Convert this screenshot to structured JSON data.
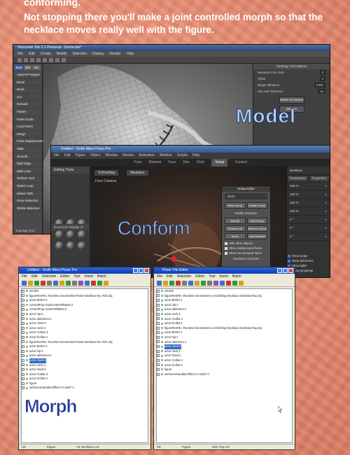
{
  "intro": {
    "line1": "conforming.",
    "line2": "Not stopping there you'll make a joint controlled morph so that the necklace moves really well with the figure."
  },
  "hexagon": {
    "title": "Hexcenter Silo 2.2 Personal - Scene.silo*",
    "menu": [
      "File",
      "Edit",
      "Create",
      "Modify",
      "Selection",
      "Display",
      "Render",
      "Help"
    ],
    "side_tabs": [
      "Mod",
      "Sel",
      "UV"
    ],
    "side_items": [
      "Append Polygon",
      "Bevel",
      "Bend",
      "Cut",
      "Extrude",
      "Flatten",
      "Insert Scale",
      "Local Move",
      "Merge",
      "Point Displacement",
      "Slide",
      "Smooth",
      "Split Edge",
      "Split Loop",
      "Surface Tool",
      "Select Loop",
      "Select Path",
      "Grow Selection",
      "Shrink Selection"
    ],
    "side_footer": "Topology Tool",
    "panel_title": "Topology Tool Options",
    "panel_rows": [
      {
        "label": "Maximum Face Size",
        "value": "0"
      },
      {
        "label": "Offset",
        "value": "0"
      },
      {
        "label": "Merge Tolerance",
        "value": "0.001"
      },
      {
        "label": "Use Auto Tolerance",
        "value": "on"
      }
    ],
    "panel_buttons": [
      "Delete All Strokes",
      "Initialize"
    ],
    "label": "Model",
    "accent": "#b8d2f5"
  },
  "poser": {
    "title": "Untitled - Smith Micro Poser Pro",
    "menu": [
      "File",
      "Edit",
      "Figure",
      "Object",
      "Window",
      "Render",
      "Animation",
      "Window",
      "Scripts",
      "Help"
    ],
    "tabs": [
      "Pose",
      "Material",
      "Face",
      "Hair",
      "Cloth",
      "Setup",
      "Content"
    ],
    "active_tab": "Setup",
    "left_header": "Editing Tools",
    "figure_dropdown": "VxDuoNeg",
    "prop_dropdown": "Necklace",
    "camera_label": "Face Camera",
    "display_header": "Document Display St",
    "right_tabs": [
      "Parameters",
      "Properties"
    ],
    "right_title": "Necklace",
    "sliders": [
      "100 %",
      "100 %",
      "100 %",
      "100 %",
      "0 °",
      "0 °",
      "0 °"
    ],
    "dialog": {
      "title": "Setup Editor",
      "dropdown": "chest",
      "buttons": [
        "New Group",
        "Delete Group"
      ],
      "section": "Modify Selection",
      "mod_buttons": [
        "Add All",
        "Add Group",
        "Remove All",
        "Remove Group",
        "Invert",
        "Add Material"
      ],
      "checks": [
        "Hide other objects",
        "Show multigrouped faces",
        "Show non-grouped faces"
      ],
      "footer": "Geometry Functions"
    },
    "show_checks": [
      "Show props",
      "Show deformers",
      "Show lights",
      "Show groupings"
    ],
    "label": "Conform"
  },
  "file_editor_left": {
    "title": "Untitled - Smith Micro Poser Pro",
    "menu": [
      "File",
      "Edit",
      "Selection",
      "Editor",
      "Tool",
      "Insert",
      "Batch"
    ],
    "tree": [
      "version",
      "figureResFile :Runtime:Geometries:Poser:Necklace:NL-Fish.obj",
      "actor BODY:4",
      "controlProp GoalCenterOfMass:4",
      "controlProp CenterOfMass:4",
      "actor hip:4",
      "actor abdomen:4",
      "actor chest:4",
      "actor neck:4",
      "actor rCollar:4",
      "actor lCollar:4",
      "figureResFile :Runtime:Geometries:Poser:Necklace:NL-Fish.obj",
      "actor BODY:4",
      "actor hip:4",
      "actor abdomen:4",
      "actor chest:4",
      "actor neck:4",
      "actor head:4",
      "actor rCollar:4",
      "actor lCollar:4",
      "figure",
      "setGeomHandlerOffset 0 0.3457 0"
    ],
    "selected_index": 15,
    "status": [
      "Ok",
      "Figure",
      "#4 Necklace.cr2"
    ],
    "label": "Morph"
  },
  "file_editor_right": {
    "title": "Poser File Editor",
    "menu": [
      "File",
      "Edit",
      "Selection",
      "Editor",
      "Tool",
      "Insert",
      "Batch"
    ],
    "tree": [
      "version",
      "figureResFile :Runtime:Geometries:LH:Clothing:Necklace:NecklaceTop.obj",
      "actor BODY:1",
      "actor hip:1",
      "actor abdomen:1",
      "actor neck:1",
      "actor rCollar:1",
      "actor lCollar:1",
      "figureResFile :Runtime:Geometries:LH:Clothing:Necklace:NecklaceTop.obj",
      "actor BODY:1",
      "actor hip:1",
      "actor abdomen:1",
      "actor chest:1",
      "actor neck:1",
      "actor head:1",
      "actor rCollar:1",
      "actor lCollar:1",
      "figure",
      "setGeomHandlerOffset 0 0.3457 0"
    ],
    "selected_index": 12,
    "status": [
      "Ok",
      "Figure",
      "Shirt Top.cr2"
    ]
  }
}
